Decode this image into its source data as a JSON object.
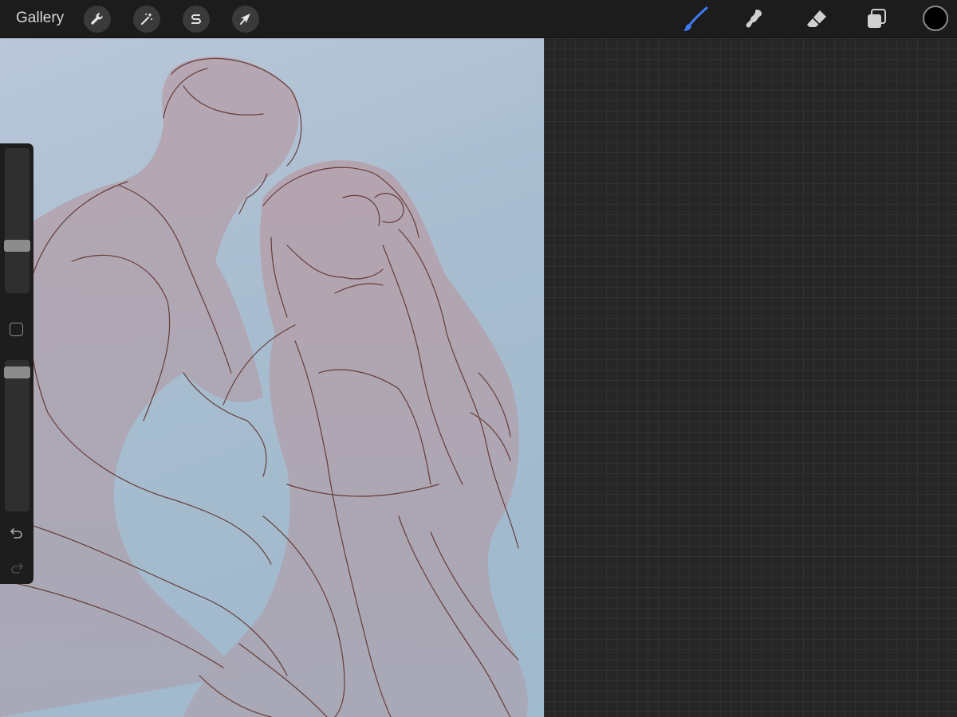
{
  "toolbar": {
    "gallery_label": "Gallery",
    "left_tools": [
      {
        "name": "actions",
        "icon": "wrench-icon"
      },
      {
        "name": "adjustments",
        "icon": "magic-wand-icon"
      },
      {
        "name": "selection",
        "icon": "selection-s-icon"
      },
      {
        "name": "transform",
        "icon": "arrow-cursor-icon"
      }
    ],
    "right_tools": [
      {
        "name": "brush",
        "icon": "brush-icon",
        "active": true
      },
      {
        "name": "smudge",
        "icon": "smudge-icon",
        "active": false
      },
      {
        "name": "eraser",
        "icon": "eraser-icon",
        "active": false
      },
      {
        "name": "layers",
        "icon": "layers-icon",
        "active": false
      }
    ],
    "current_color": "#000000",
    "active_tool_color": "#3d7bf5"
  },
  "sidebar": {
    "brush_size_level": 0.35,
    "brush_opacity_level": 1.0
  }
}
